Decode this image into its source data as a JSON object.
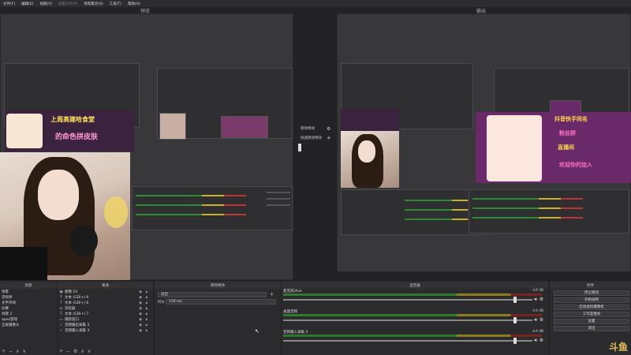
{
  "menu": [
    "文件(F)",
    "编辑(E)",
    "视图(V)",
    "配置文件(P)",
    "场景集合(S)",
    "工具(T)",
    "帮助(H)"
  ],
  "preview_label": "预览",
  "program_label": "输出",
  "transition_mid": {
    "item1": "转场特效",
    "item2": "快速转场特效"
  },
  "banner": {
    "left_top": "上周高建哈食堂",
    "left_bottom": "的命色拼皮肤",
    "right_line1": "抖音快手同名",
    "right_line2": "粉丝群",
    "right_line3": "直播间",
    "right_line4": "欢迎你的加入"
  },
  "scenes": {
    "title": "场景",
    "items": [
      "场景",
      "音响师",
      "文字开场",
      "比赛",
      "场景 2",
      "apex游戏",
      "全屏摄像头"
    ]
  },
  "sources": {
    "title": "来源",
    "items": [
      {
        "icon": "image-icon",
        "glyph": "▣",
        "label": "图像 10"
      },
      {
        "icon": "text-icon",
        "glyph": "T",
        "label": "文本 (GDI+) 6"
      },
      {
        "icon": "text-icon",
        "glyph": "T",
        "label": "文本 (GDI+) 8"
      },
      {
        "icon": "browser-icon",
        "glyph": "◎",
        "label": "浏览器"
      },
      {
        "icon": "text-icon",
        "glyph": "T",
        "label": "文本 (GDI+) 7"
      },
      {
        "icon": "window-capture-icon",
        "glyph": "▭",
        "label": "捕获窗口"
      },
      {
        "icon": "audio-output-icon",
        "glyph": "♪",
        "label": "音频输出采集 3"
      },
      {
        "icon": "audio-input-icon",
        "glyph": "♪",
        "label": "音频输入采集 3"
      }
    ]
  },
  "transitions": {
    "title": "转场特效",
    "select_value": "淡出",
    "duration_label": "时长",
    "duration_value": "150 ms"
  },
  "mixer": {
    "title": "混音器",
    "channels": [
      {
        "name": "麦克风/Aux",
        "db": "-inf dB",
        "volume": 0.93
      },
      {
        "name": "桌面音频",
        "db": "-inf dB",
        "volume": 0.93
      },
      {
        "name": "音频输入采集 3",
        "db": "-inf dB",
        "volume": 0.93
      }
    ]
  },
  "controls": {
    "title": "控件",
    "buttons": [
      "停止推流",
      "开始录制",
      "启动虚拟摄像机",
      "工作室模式",
      "设置",
      "退出"
    ]
  },
  "watermark": "斗鱼",
  "colors": {
    "accent_green": "#2e8b2e",
    "accent_yellow": "#c9b22b",
    "accent_red": "#b33333",
    "banner_purple": "#6a2a6a",
    "banner_yellow": "#ffd84a"
  }
}
